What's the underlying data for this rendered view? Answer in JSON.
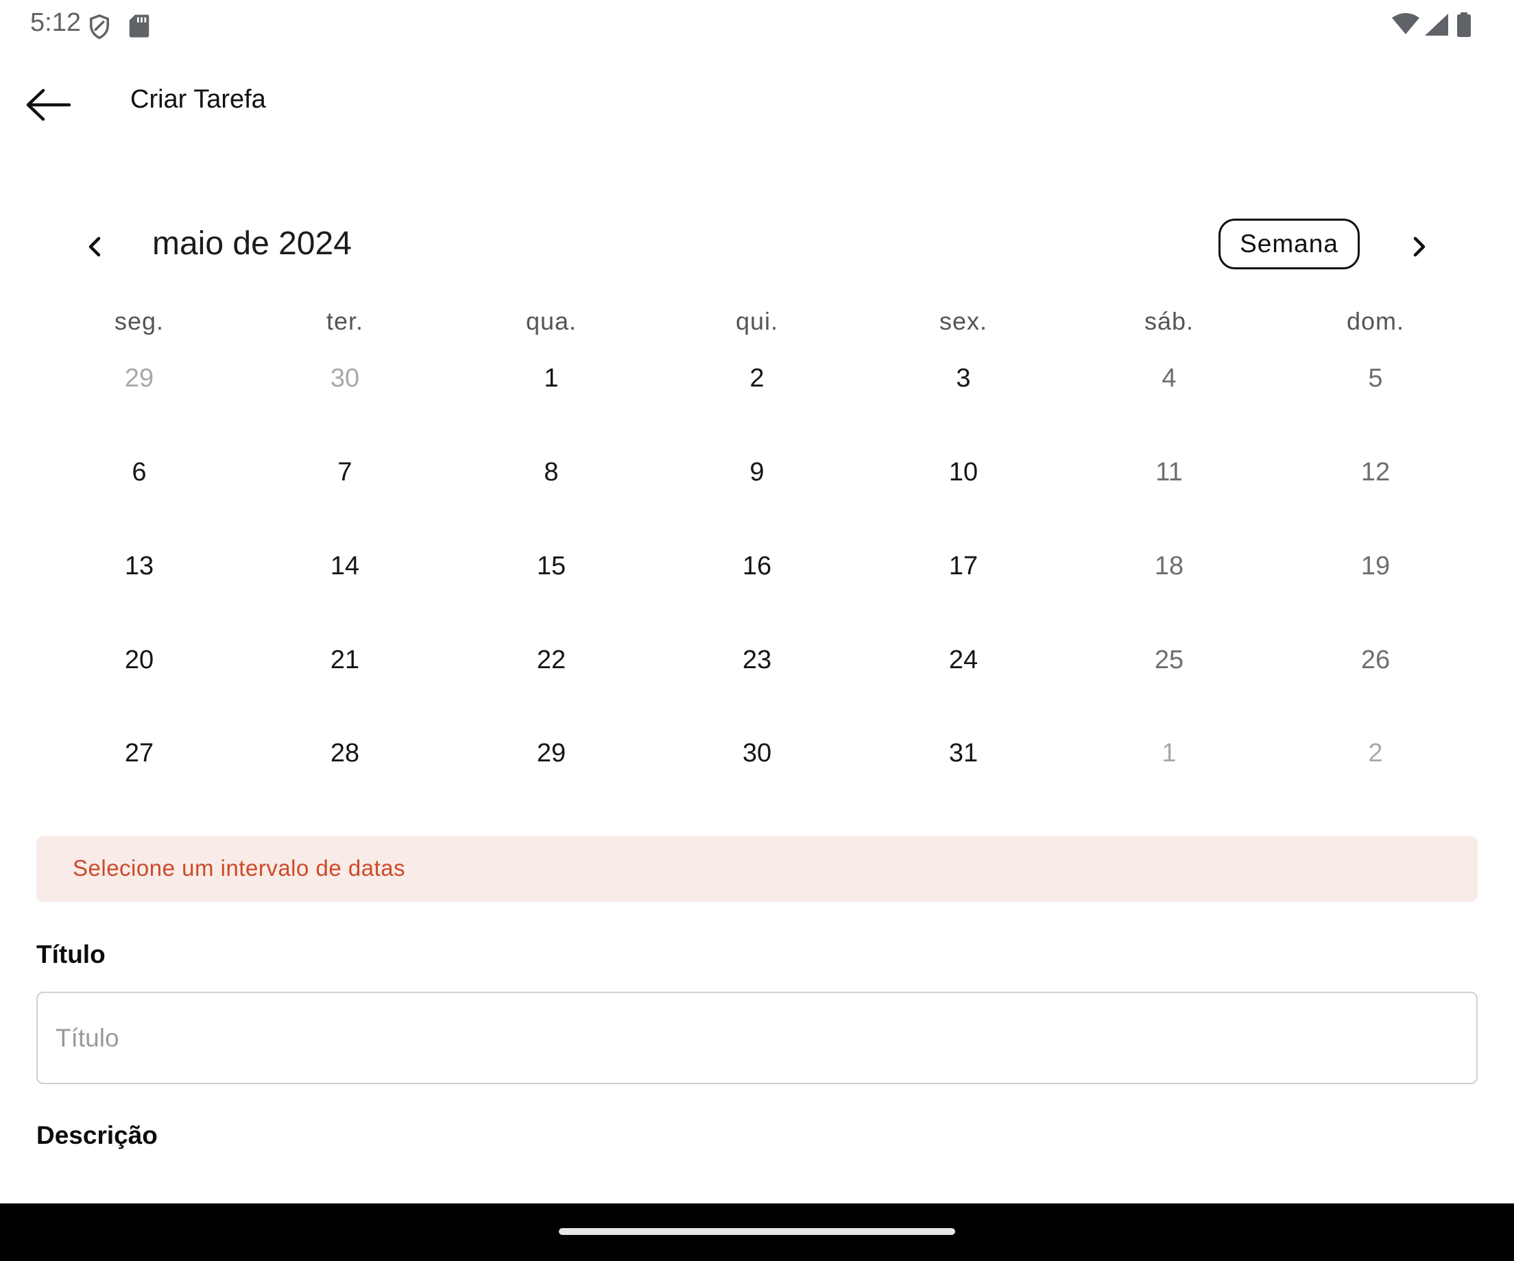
{
  "status_bar": {
    "time": "5:12"
  },
  "app_bar": {
    "title": "Criar Tarefa"
  },
  "calendar": {
    "month_label": "maio de 2024",
    "week_toggle_label": "Semana",
    "weekdays": [
      "seg.",
      "ter.",
      "qua.",
      "qui.",
      "sex.",
      "sáb.",
      "dom."
    ],
    "weeks": [
      [
        "29",
        "30",
        "1",
        "2",
        "3",
        "4",
        "5"
      ],
      [
        "6",
        "7",
        "8",
        "9",
        "10",
        "11",
        "12"
      ],
      [
        "13",
        "14",
        "15",
        "16",
        "17",
        "18",
        "19"
      ],
      [
        "20",
        "21",
        "22",
        "23",
        "24",
        "25",
        "26"
      ],
      [
        "27",
        "28",
        "29",
        "30",
        "31",
        "1",
        "2"
      ]
    ]
  },
  "error_banner": {
    "text": "Selecione um intervalo de datas"
  },
  "form": {
    "title_label": "Título",
    "title_placeholder": "Título",
    "title_value": "",
    "description_label": "Descrição"
  },
  "colors": {
    "error_text": "#cc4a2a",
    "error_background": "#f9ebe7",
    "muted_day": "#a8a8a8"
  }
}
